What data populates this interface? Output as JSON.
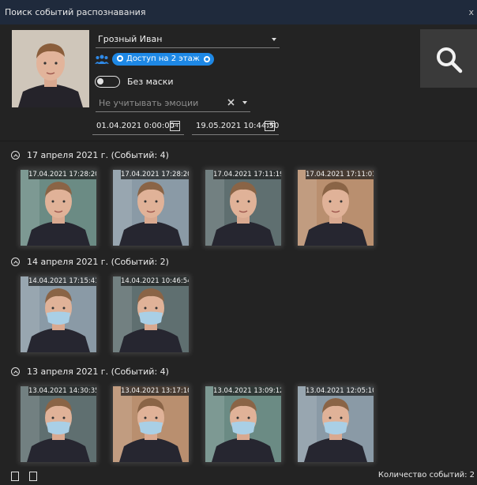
{
  "window": {
    "title": "Поиск событий распознавания",
    "close_label": "x"
  },
  "filters": {
    "person_name": "Грозный Иван",
    "access_tag": "Доступ на 2 этаж",
    "mask_toggle_label": "Без маски",
    "mask_toggle_on": false,
    "emotion_placeholder": "Не учитывать эмоции",
    "date_from": "01.04.2021 0:00:00",
    "date_to": "19.05.2021 10:44:50",
    "calendar_glyph": "14"
  },
  "groups": [
    {
      "header": "17 апреля 2021 г. (Событий: 4)",
      "events": [
        {
          "timestamp": "17.04.2021 17:28:20",
          "mask": false
        },
        {
          "timestamp": "17.04.2021 17:28:20",
          "mask": false
        },
        {
          "timestamp": "17.04.2021 17:11:19",
          "mask": false
        },
        {
          "timestamp": "17.04.2021 17:11:01",
          "mask": false
        }
      ]
    },
    {
      "header": "14 апреля 2021 г. (Событий: 2)",
      "events": [
        {
          "timestamp": "14.04.2021 17:15:41",
          "mask": true
        },
        {
          "timestamp": "14.04.2021 10:46:54",
          "mask": true
        }
      ]
    },
    {
      "header": "13 апреля 2021 г. (Событий: 4)",
      "events": [
        {
          "timestamp": "13.04.2021 14:30:35",
          "mask": true
        },
        {
          "timestamp": "13.04.2021 13:17:10",
          "mask": true
        },
        {
          "timestamp": "13.04.2021 13:09:12",
          "mask": true
        },
        {
          "timestamp": "13.04.2021 12:05:10",
          "mask": true
        }
      ]
    }
  ],
  "footer": {
    "count_label": "Количество событий: 2"
  },
  "icons": {
    "search": "search-icon",
    "group": "users-icon",
    "export": "export-icon",
    "report": "report-icon",
    "clear": "clear-icon"
  }
}
